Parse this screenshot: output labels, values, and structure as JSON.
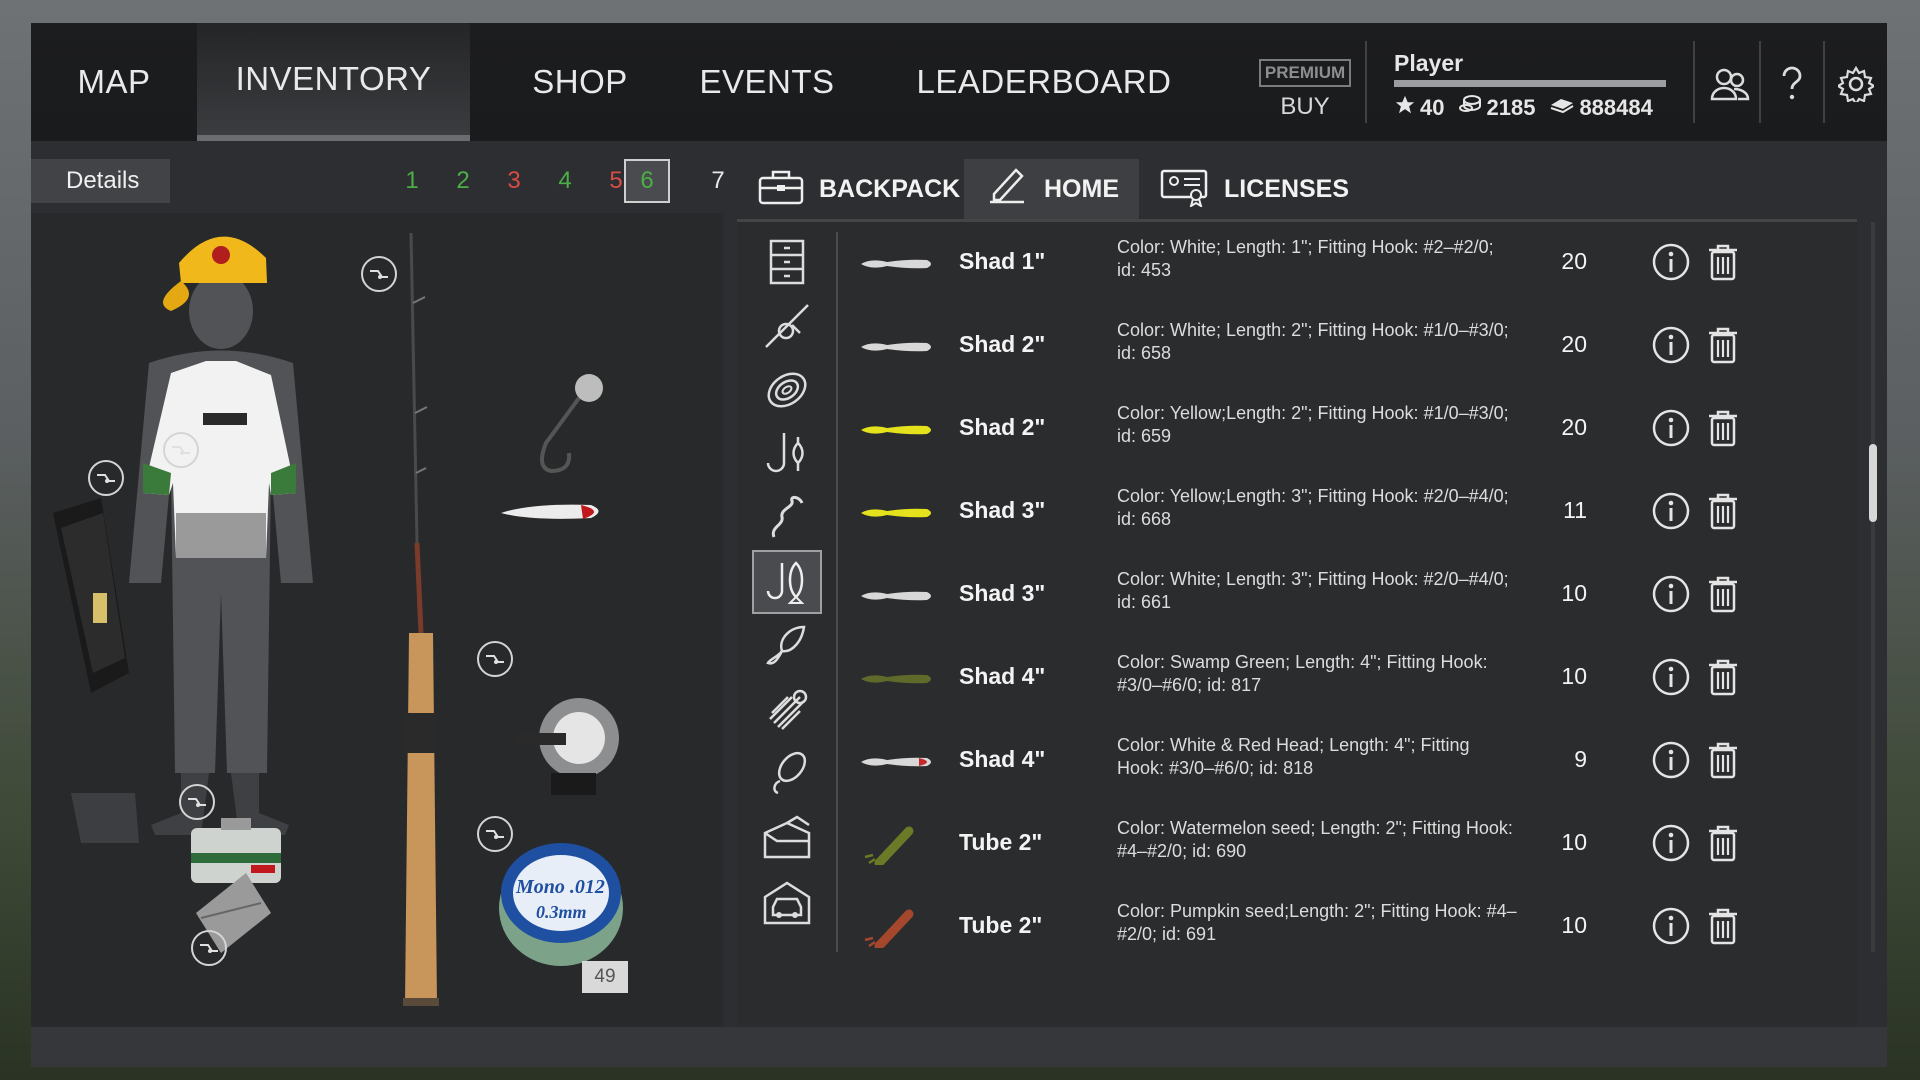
{
  "nav": {
    "tabs": [
      {
        "label": "MAP"
      },
      {
        "label": "INVENTORY"
      },
      {
        "label": "SHOP"
      },
      {
        "label": "EVENTS"
      },
      {
        "label": "LEADERBOARD"
      }
    ],
    "premium_label": "PREMIUM",
    "buy_label": "BUY",
    "player": {
      "name": "Player",
      "xp_progress": 1.0,
      "level": "40",
      "silver": "2185",
      "gold": "888484"
    },
    "icons": [
      "friends-icon",
      "help-icon",
      "settings-icon"
    ]
  },
  "left": {
    "details_label": "Details",
    "pages": [
      {
        "label": "1",
        "color": "#4cae46"
      },
      {
        "label": "2",
        "color": "#4cae46"
      },
      {
        "label": "3",
        "color": "#d84c46"
      },
      {
        "label": "4",
        "color": "#4cae46"
      },
      {
        "label": "5",
        "color": "#d84c46"
      },
      {
        "label": "6",
        "color": "#4cae46"
      },
      {
        "label": "7",
        "color": "#e8e8e8"
      }
    ],
    "active_page": "6",
    "line_count": "49"
  },
  "inventory_tabs": [
    {
      "label": "BACKPACK",
      "icon": "tackle-box-icon"
    },
    {
      "label": "HOME",
      "icon": "home-edit-icon"
    },
    {
      "label": "LICENSES",
      "icon": "license-icon"
    }
  ],
  "categories": [
    "drawers-icon",
    "rod-reel-icon",
    "line-spool-icon",
    "hook-float-icon",
    "worm-icon",
    "bait-fish-icon",
    "spoon-lure-icon",
    "jig-icon",
    "spinner-icon",
    "box-icon",
    "car-icon"
  ],
  "items": [
    {
      "name": "Shad 1\"",
      "desc": "Color: White; Length: 1\"; Fitting Hook: #2–#2/0; id: 453",
      "qty": "20",
      "color": "#d8d8d8",
      "head": "#d8d8d8",
      "kind": "shad"
    },
    {
      "name": "Shad 2\"",
      "desc": "Color: White; Length: 2\"; Fitting Hook: #1/0–#3/0; id: 658",
      "qty": "20",
      "color": "#d8d8d8",
      "head": "#d8d8d8",
      "kind": "shad"
    },
    {
      "name": "Shad 2\"",
      "desc": "Color: Yellow;Length: 2\"; Fitting Hook: #1/0–#3/0; id: 659",
      "qty": "20",
      "color": "#e4e21c",
      "head": "#e4e21c",
      "kind": "shad"
    },
    {
      "name": "Shad 3\"",
      "desc": "Color: Yellow;Length: 3\"; Fitting Hook: #2/0–#4/0; id: 668",
      "qty": "11",
      "color": "#e4e21c",
      "head": "#e4e21c",
      "kind": "shad"
    },
    {
      "name": "Shad 3\"",
      "desc": "Color: White; Length: 3\"; Fitting Hook: #2/0–#4/0; id: 661",
      "qty": "10",
      "color": "#d8d8d8",
      "head": "#d8d8d8",
      "kind": "shad"
    },
    {
      "name": "Shad 4\"",
      "desc": "Color: Swamp Green; Length: 4\"; Fitting Hook: #3/0–#6/0; id: 817",
      "qty": "10",
      "color": "#5f6a2a",
      "head": "#5f6a2a",
      "kind": "shad"
    },
    {
      "name": "Shad 4\"",
      "desc": "Color: White & Red Head; Length: 4\"; Fitting Hook: #3/0–#6/0; id: 818",
      "qty": "9",
      "color": "#d8d8d8",
      "head": "#c8282a",
      "kind": "shad"
    },
    {
      "name": "Tube 2\"",
      "desc": "Color: Watermelon seed; Length: 2\"; Fitting Hook: #4–#2/0; id: 690",
      "qty": "10",
      "color": "#6b7a26",
      "head": "#6b7a26",
      "kind": "tube"
    },
    {
      "name": "Tube 2\"",
      "desc": "Color: Pumpkin seed;Length: 2\"; Fitting Hook: #4–#2/0; id: 691",
      "qty": "10",
      "color": "#a4472d",
      "head": "#a4472d",
      "kind": "tube"
    }
  ]
}
